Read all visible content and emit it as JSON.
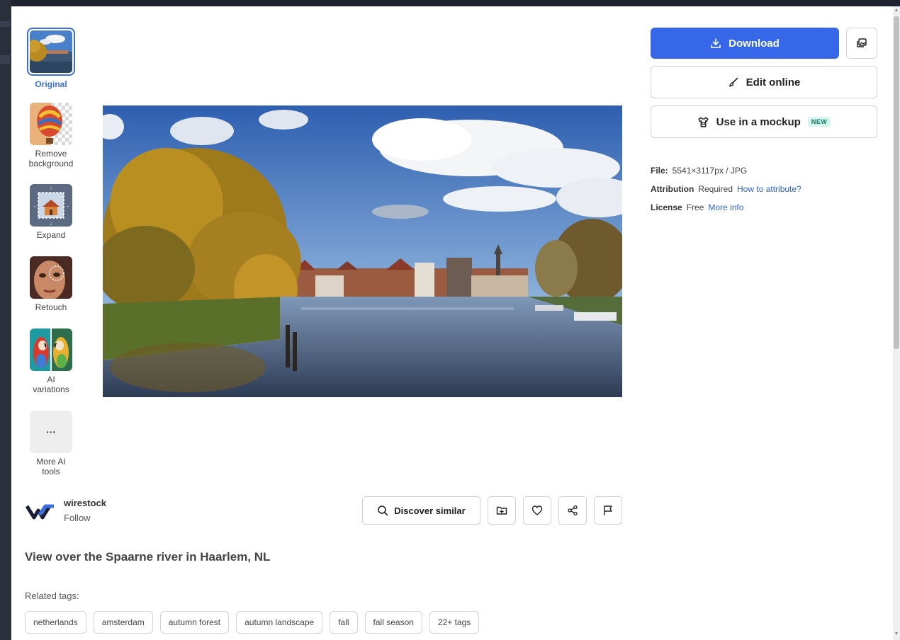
{
  "tools": [
    {
      "label": "Original",
      "active": true,
      "icon": "river-thumbnail"
    },
    {
      "label": "Remove background",
      "active": false,
      "icon": "balloon-thumbnail"
    },
    {
      "label": "Expand",
      "active": false,
      "icon": "house-expand-thumbnail"
    },
    {
      "label": "Retouch",
      "active": false,
      "icon": "face-retouch-thumbnail"
    },
    {
      "label": "AI variations",
      "active": false,
      "icon": "parrots-thumbnail"
    },
    {
      "label": "More AI tools",
      "active": false,
      "icon": "more-dots-icon",
      "glyph": "···"
    }
  ],
  "actions": {
    "download_label": "Download",
    "edit_online_label": "Edit online",
    "mockup_label": "Use in a mockup",
    "mockup_badge": "NEW",
    "discover_similar_label": "Discover similar"
  },
  "file_info": {
    "file_key": "File:",
    "file_value": "5541×3117px / JPG",
    "attribution_key": "Attribution",
    "attribution_value": "Required",
    "attribution_link": "How to attribute?",
    "license_key": "License",
    "license_value": "Free",
    "license_link": "More info"
  },
  "author": {
    "name": "wirestock",
    "follow_label": "Follow"
  },
  "image": {
    "title": "View over the Spaarne river in Haarlem, NL"
  },
  "tags": {
    "label": "Related tags:",
    "items": [
      "netherlands",
      "amsterdam",
      "autumn forest",
      "autumn landscape",
      "fall",
      "fall season",
      "22+ tags"
    ]
  },
  "colors": {
    "accent": "#3667e8",
    "link": "#2f63d6",
    "badge_bg": "#d6f5ef",
    "badge_text": "#0f7a66"
  }
}
